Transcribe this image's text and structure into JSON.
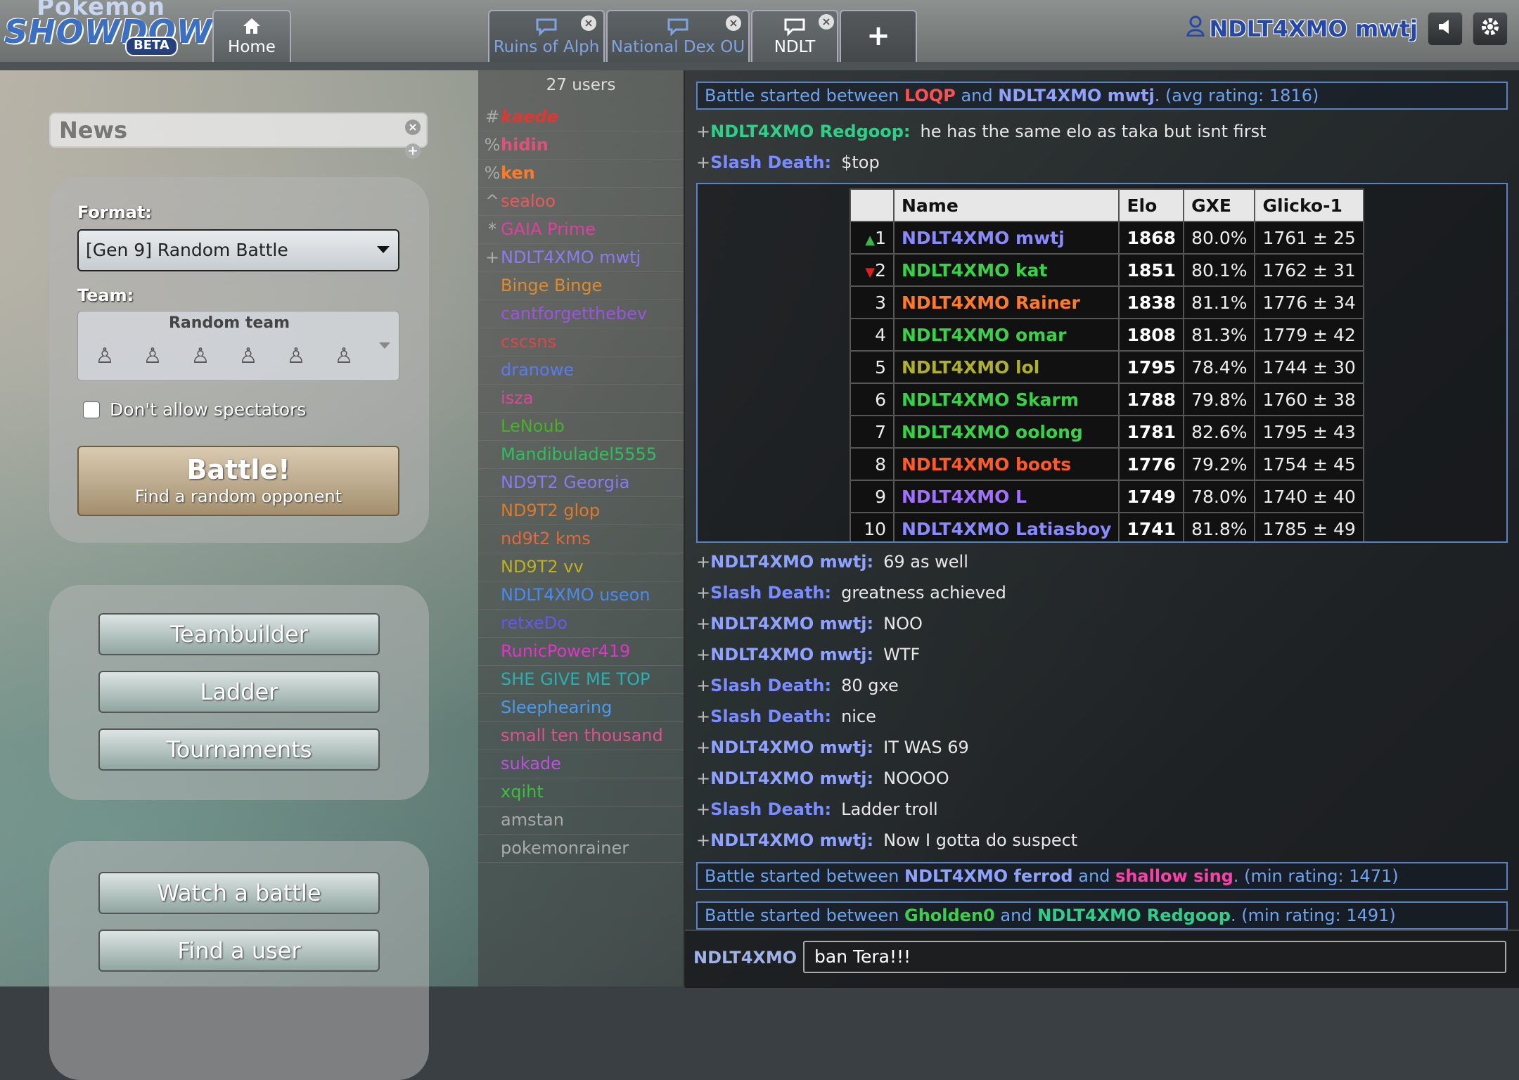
{
  "logo": {
    "line1": "Pokémon",
    "line2": "SHOWDOWN!",
    "badge": "BETA"
  },
  "tabs": {
    "home": "Home",
    "rooms": [
      {
        "label": "Ruins of Alph",
        "icon": "chat-bubble-icon"
      },
      {
        "label": "National Dex OU",
        "icon": "chat-bubble-icon"
      },
      {
        "label": "NDLT",
        "icon": "chat-bubble-icon"
      }
    ],
    "plus": "+"
  },
  "user": {
    "name": "NDLT4XMO mwtj"
  },
  "main_menu": {
    "news_title": "News",
    "format_label": "Format:",
    "format_value": "[Gen 9] Random Battle",
    "team_label": "Team:",
    "team_value": "Random team",
    "spectators_label": "Don't allow spectators",
    "battle_title": "Battle!",
    "battle_sub": "Find a random opponent",
    "buttons1": [
      "Teambuilder",
      "Ladder",
      "Tournaments"
    ],
    "buttons2": [
      "Watch a battle",
      "Find a user"
    ]
  },
  "userlist": {
    "count": "27 users",
    "users": [
      {
        "sym": "#",
        "name": "kaede",
        "color": "#e8342f",
        "style": "bold-italic"
      },
      {
        "sym": "%",
        "name": "hidin",
        "color": "#e0507a",
        "style": "bold"
      },
      {
        "sym": "%",
        "name": "ken",
        "color": "#ff7a24",
        "style": "bold"
      },
      {
        "sym": "^",
        "name": "sealoo",
        "color": "#e85a5a",
        "style": ""
      },
      {
        "sym": "*",
        "name": "GAIA Prime",
        "color": "#e03fa0",
        "style": ""
      },
      {
        "sym": "+",
        "name": "NDLT4XMO mwtj",
        "color": "#8a7cf0",
        "style": ""
      },
      {
        "sym": "",
        "name": "Binge Binge",
        "color": "#e08a2a",
        "style": ""
      },
      {
        "sym": "",
        "name": "cantforgetthebev",
        "color": "#9a55e0",
        "style": ""
      },
      {
        "sym": "",
        "name": "cscsns",
        "color": "#e04545",
        "style": ""
      },
      {
        "sym": "",
        "name": "dranowe",
        "color": "#5a7af0",
        "style": ""
      },
      {
        "sym": "",
        "name": "isza",
        "color": "#e0459a",
        "style": ""
      },
      {
        "sym": "",
        "name": "LeNoub",
        "color": "#4ab02a",
        "style": ""
      },
      {
        "sym": "",
        "name": "Mandibuladel5555",
        "color": "#2fbf5a",
        "style": ""
      },
      {
        "sym": "",
        "name": "ND9T2 Georgia",
        "color": "#8a7af0",
        "style": ""
      },
      {
        "sym": "",
        "name": "ND9T2 glop",
        "color": "#e07a2a",
        "style": ""
      },
      {
        "sym": "",
        "name": "nd9t2 kms",
        "color": "#e06a3a",
        "style": ""
      },
      {
        "sym": "",
        "name": "ND9T2 vv",
        "color": "#c0b020",
        "style": ""
      },
      {
        "sym": "",
        "name": "NDLT4XMO useon",
        "color": "#4a8af0",
        "style": ""
      },
      {
        "sym": "",
        "name": "retxeDo",
        "color": "#6a55f0",
        "style": ""
      },
      {
        "sym": "",
        "name": "RunicPower419",
        "color": "#e035c8",
        "style": ""
      },
      {
        "sym": "",
        "name": "SHE GIVE ME TOP",
        "color": "#2ab0b0",
        "style": ""
      },
      {
        "sym": "",
        "name": "Sleephearing",
        "color": "#4a9af0",
        "style": ""
      },
      {
        "sym": "",
        "name": "small ten thousand",
        "color": "#e05090",
        "style": ""
      },
      {
        "sym": "",
        "name": "sukade",
        "color": "#c050e0",
        "style": ""
      },
      {
        "sym": "",
        "name": "xqiht",
        "color": "#3ac03a",
        "style": ""
      },
      {
        "sym": "",
        "name": "amstan",
        "color": "#aaaaaa",
        "style": ""
      },
      {
        "sym": "",
        "name": "pokemonrainer",
        "color": "#aaaaaa",
        "style": ""
      }
    ]
  },
  "chat": {
    "notice1": {
      "pre": "Battle started between ",
      "p1": "LOQP",
      "p1c": "#ff5050",
      "mid": " and ",
      "p2": "NDLT4XMO mwtj",
      "p2c": "#8fa2ff",
      "post": ". (avg rating: 1816)"
    },
    "messages_top": [
      {
        "author": "NDLT4XMO Redgoop:",
        "color": "#2fcf8a",
        "text": "he has the same elo as taka but isnt first"
      },
      {
        "author": "Slash Death:",
        "color": "#7a8cff",
        "text": "$top"
      }
    ],
    "ladder": {
      "headers": [
        "",
        "Name",
        "Elo",
        "GXE",
        "Glicko-1"
      ],
      "rows": [
        {
          "trend": "▲",
          "rank": "1",
          "name": "NDLT4XMO mwtj",
          "color": "#8a8aff",
          "elo": "1868",
          "gxe": "80.0%",
          "glicko": "1761 ± 25"
        },
        {
          "trend": "▼",
          "rank": "2",
          "name": "NDLT4XMO kat",
          "color": "#3ad04a",
          "elo": "1851",
          "gxe": "80.1%",
          "glicko": "1762 ± 31"
        },
        {
          "trend": "",
          "rank": "3",
          "name": "NDLT4XMO Rainer",
          "color": "#ff7a2a",
          "elo": "1838",
          "gxe": "81.1%",
          "glicko": "1776 ± 34"
        },
        {
          "trend": "",
          "rank": "4",
          "name": "NDLT4XMO omar",
          "color": "#3ad04a",
          "elo": "1808",
          "gxe": "81.3%",
          "glicko": "1779 ± 42"
        },
        {
          "trend": "",
          "rank": "5",
          "name": "NDLT4XMO lol",
          "color": "#b0b030",
          "elo": "1795",
          "gxe": "78.4%",
          "glicko": "1744 ± 30"
        },
        {
          "trend": "",
          "rank": "6",
          "name": "NDLT4XMO Skarm",
          "color": "#3ad04a",
          "elo": "1788",
          "gxe": "79.8%",
          "glicko": "1760 ± 38"
        },
        {
          "trend": "",
          "rank": "7",
          "name": "NDLT4XMO oolong",
          "color": "#3ad04a",
          "elo": "1781",
          "gxe": "82.6%",
          "glicko": "1795 ± 43"
        },
        {
          "trend": "",
          "rank": "8",
          "name": "NDLT4XMO boots",
          "color": "#ff5a2a",
          "elo": "1776",
          "gxe": "79.2%",
          "glicko": "1754 ± 45"
        },
        {
          "trend": "",
          "rank": "9",
          "name": "NDLT4XMO L",
          "color": "#a070ff",
          "elo": "1749",
          "gxe": "78.0%",
          "glicko": "1740 ± 40"
        },
        {
          "trend": "",
          "rank": "10",
          "name": "NDLT4XMO Latiasboy",
          "color": "#8a8aff",
          "elo": "1741",
          "gxe": "81.8%",
          "glicko": "1785 ± 49"
        }
      ]
    },
    "messages": [
      {
        "author": "NDLT4XMO mwtj:",
        "color": "#8fa2ff",
        "text": "69 as well"
      },
      {
        "author": "Slash Death:",
        "color": "#7a8cff",
        "text": "greatness achieved"
      },
      {
        "author": "NDLT4XMO mwtj:",
        "color": "#8fa2ff",
        "text": "NOO"
      },
      {
        "author": "NDLT4XMO mwtj:",
        "color": "#8fa2ff",
        "text": "WTF"
      },
      {
        "author": "Slash Death:",
        "color": "#7a8cff",
        "text": "80 gxe"
      },
      {
        "author": "Slash Death:",
        "color": "#7a8cff",
        "text": "nice"
      },
      {
        "author": "NDLT4XMO mwtj:",
        "color": "#8fa2ff",
        "text": "IT WAS 69"
      },
      {
        "author": "NDLT4XMO mwtj:",
        "color": "#8fa2ff",
        "text": "NOOOO"
      },
      {
        "author": "Slash Death:",
        "color": "#7a8cff",
        "text": "Ladder troll"
      },
      {
        "author": "NDLT4XMO mwtj:",
        "color": "#8fa2ff",
        "text": "Now I gotta do suspect"
      }
    ],
    "notice2": {
      "pre": "Battle started between ",
      "p1": "NDLT4XMO ferrod",
      "p1c": "#8fa2ff",
      "mid": " and ",
      "p2": "shallow sing",
      "p2c": "#ff3fa8",
      "post": ". (min rating: 1471)"
    },
    "notice3": {
      "pre": "Battle started between ",
      "p1": "Gholden0",
      "p1c": "#3ad04a",
      "mid": " and ",
      "p2": "NDLT4XMO Redgoop",
      "p2c": "#2fcf8a",
      "post": ". (min rating: 1491)"
    },
    "composer_name": "NDLT4XMO",
    "composer_value": "ban Tera!!!"
  }
}
